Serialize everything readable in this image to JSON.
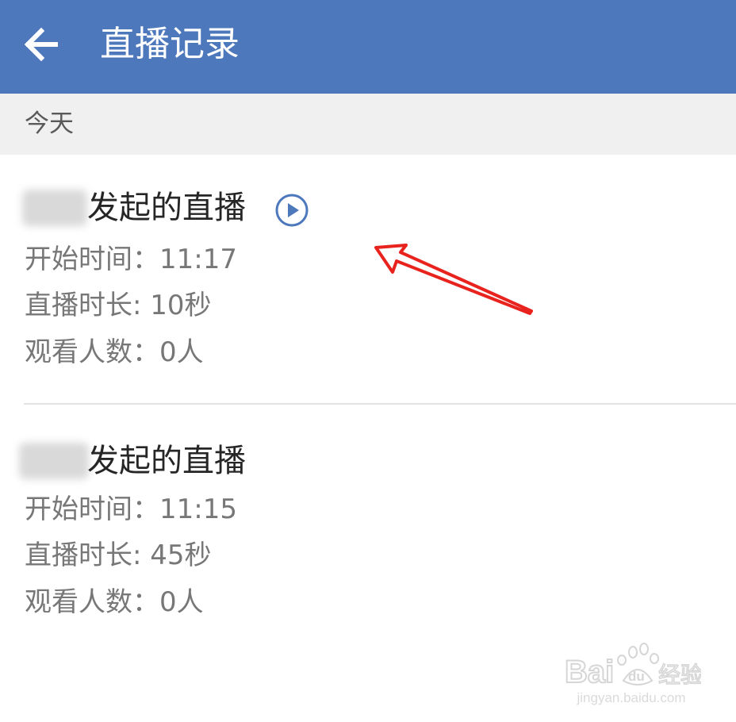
{
  "app_bar": {
    "title": "直播记录",
    "back_icon": "arrow-left-icon",
    "background": "#4e78bc"
  },
  "section": {
    "label": "今天"
  },
  "records": [
    {
      "title": "发起的直播",
      "play_icon": "play-circle-icon",
      "start_time": "开始时间：11:17",
      "duration": "直播时长: 10秒",
      "viewers": "观看人数：0人"
    },
    {
      "title": "发起的直播",
      "start_time": "开始时间：11:15",
      "duration": "直播时长: 45秒",
      "viewers": "观看人数：0人"
    }
  ],
  "annotation": {
    "arrow_color": "#e8231e"
  },
  "watermark": {
    "logo_text": "Bai du 经验",
    "url": "jingyan.baidu.com"
  }
}
